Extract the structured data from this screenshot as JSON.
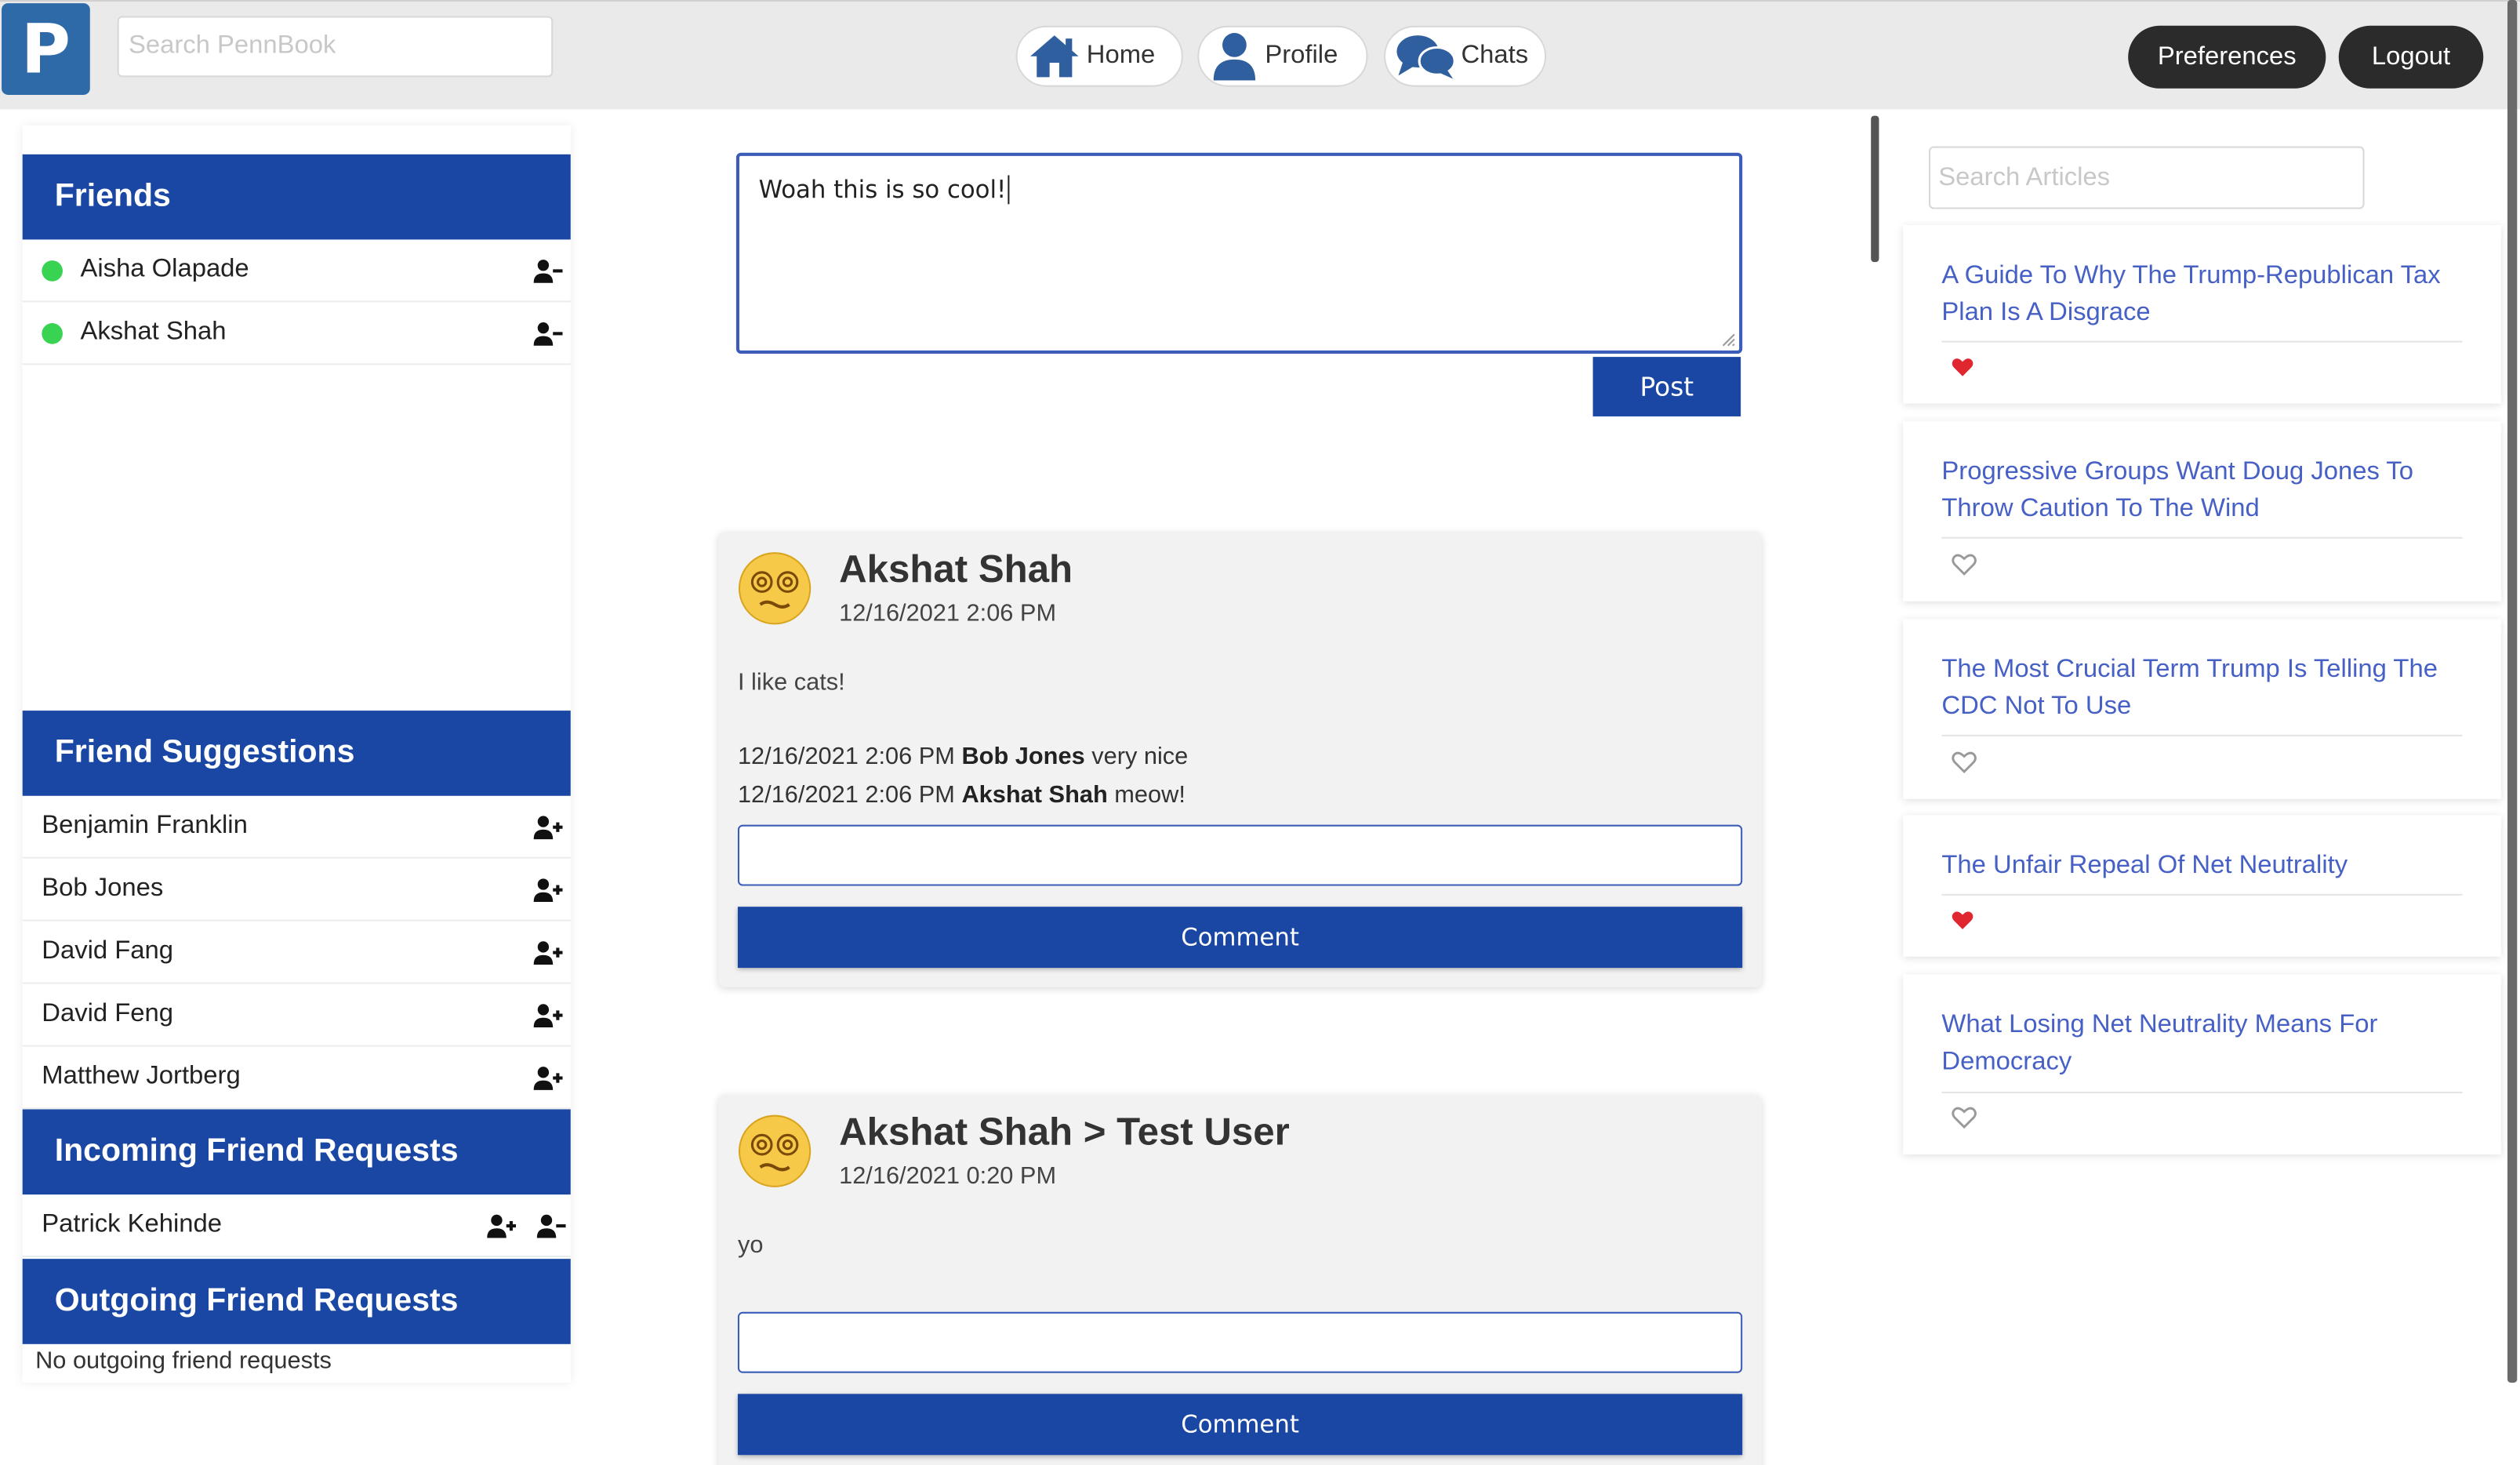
{
  "app": {
    "logo_letter": "P",
    "search_placeholder": "Search PennBook"
  },
  "nav": {
    "home": "Home",
    "profile": "Profile",
    "chats": "Chats",
    "preferences": "Preferences",
    "logout": "Logout"
  },
  "colors": {
    "primary": "#1947a3",
    "online": "#39d353",
    "link": "#4660c5",
    "heart": "#e0262f"
  },
  "sidebar": {
    "friends": {
      "title": "Friends",
      "items": [
        {
          "name": "Aisha Olapade",
          "online": true
        },
        {
          "name": "Akshat Shah",
          "online": true
        }
      ]
    },
    "suggestions": {
      "title": "Friend Suggestions",
      "items": [
        "Benjamin Franklin",
        "Bob Jones",
        "David Fang",
        "David Feng",
        "Matthew Jortberg"
      ]
    },
    "incoming": {
      "title": "Incoming Friend Requests",
      "items": [
        "Patrick Kehinde"
      ]
    },
    "outgoing": {
      "title": "Outgoing Friend Requests",
      "empty_text": "No outgoing friend requests"
    }
  },
  "composer": {
    "value": "Woah this is so cool!",
    "post_label": "Post"
  },
  "posts": [
    {
      "author": "Akshat Shah",
      "timestamp": "12/16/2021 2:06 PM",
      "content": "I like cats!",
      "comments": [
        {
          "time": "12/16/2021 2:06 PM",
          "author": "Bob Jones",
          "text": "very nice"
        },
        {
          "time": "12/16/2021 2:06 PM",
          "author": "Akshat Shah",
          "text": "meow!"
        }
      ],
      "comment_label": "Comment"
    },
    {
      "author": "Akshat Shah > Test User",
      "timestamp": "12/16/2021 0:20 PM",
      "content": "yo",
      "comments": [],
      "comment_label": "Comment"
    }
  ],
  "articles": {
    "search_placeholder": "Search Articles",
    "items": [
      {
        "title": "A Guide To Why The Trump-Republican Tax Plan Is A Disgrace",
        "liked": true
      },
      {
        "title": "Progressive Groups Want Doug Jones To Throw Caution To The Wind",
        "liked": false
      },
      {
        "title": "The Most Crucial Term Trump Is Telling The CDC Not To Use",
        "liked": false
      },
      {
        "title": "The Unfair Repeal Of Net Neutrality",
        "liked": true
      },
      {
        "title": "What Losing Net Neutrality Means For Democracy",
        "liked": false
      }
    ]
  }
}
